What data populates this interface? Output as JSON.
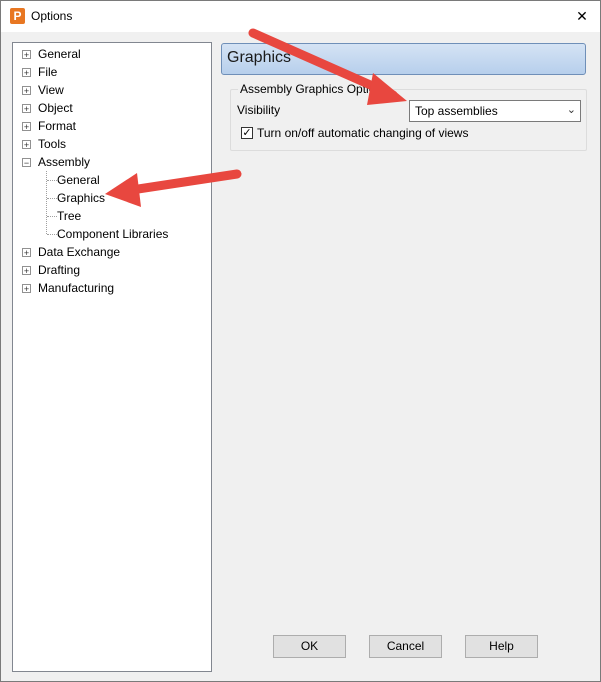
{
  "window": {
    "title": "Options",
    "app_icon": "P",
    "close_label": "✕"
  },
  "tree": {
    "items": [
      {
        "label": "General",
        "expander": "+"
      },
      {
        "label": "File",
        "expander": "+"
      },
      {
        "label": "View",
        "expander": "+"
      },
      {
        "label": "Object",
        "expander": "+"
      },
      {
        "label": "Format",
        "expander": "+"
      },
      {
        "label": "Tools",
        "expander": "+"
      },
      {
        "label": "Assembly",
        "expander": "−"
      },
      {
        "label": "Data Exchange",
        "expander": "+"
      },
      {
        "label": "Drafting",
        "expander": "+"
      },
      {
        "label": "Manufacturing",
        "expander": "+"
      }
    ],
    "assembly_children": [
      {
        "label": "General"
      },
      {
        "label": "Graphics"
      },
      {
        "label": "Tree"
      },
      {
        "label": "Component Libraries"
      }
    ]
  },
  "panel": {
    "header": "Graphics",
    "group_title": "Assembly Graphics Optio",
    "visibility_label": "Visibility",
    "visibility_value": "Top assemblies",
    "chevron": "⌄",
    "checkbox_mark": "✓",
    "checkbox_label": "Turn on/off automatic changing of views",
    "checkbox_checked": true
  },
  "buttons": {
    "ok": "OK",
    "cancel": "Cancel",
    "help": "Help"
  },
  "colors": {
    "annotation_arrow": "#e8473f",
    "header_gradient": "#c5d9f1"
  }
}
